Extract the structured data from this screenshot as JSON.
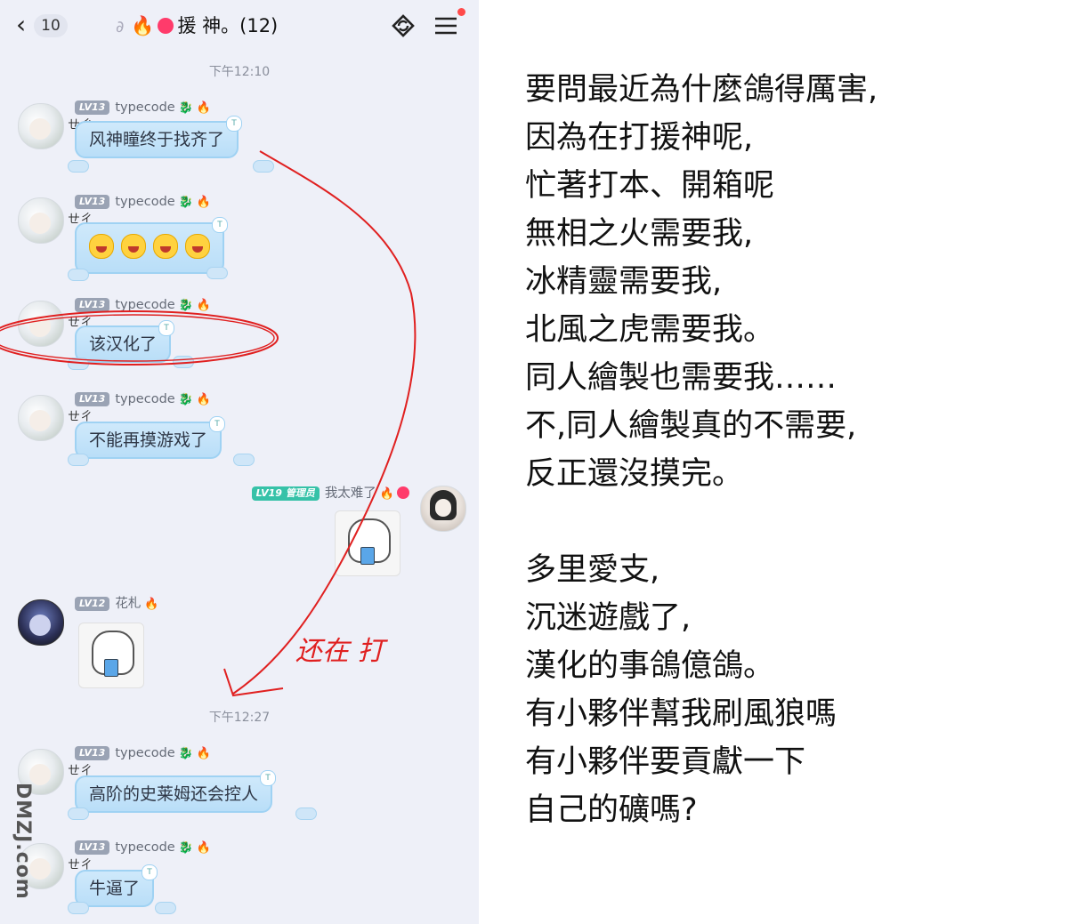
{
  "header": {
    "unread_count": "10",
    "group_title": "援 神。(12)"
  },
  "timestamps": [
    "下午12:10",
    "下午12:27"
  ],
  "messages": [
    {
      "level": "LV13",
      "user": "typecode",
      "text": "风神瞳终于找齐了"
    },
    {
      "level": "LV13",
      "user": "typecode",
      "text": ""
    },
    {
      "level": "LV13",
      "user": "typecode",
      "text": "该汉化了"
    },
    {
      "level": "LV13",
      "user": "typecode",
      "text": "不能再摸游戏了"
    },
    {
      "level": "LV19",
      "role": "管理员",
      "user": "我太难了"
    },
    {
      "level": "LV12",
      "user": "花札"
    },
    {
      "level": "LV13",
      "user": "typecode",
      "text": "高阶的史莱姆还会控人"
    },
    {
      "level": "LV13",
      "user": "typecode",
      "text": "牛逼了"
    }
  ],
  "handwritten_note": "还在 打",
  "watermark": "DMZJ.com",
  "poem": [
    "要問最近為什麼鴿得厲害,",
    "因為在打援神呢,",
    "忙著打本、開箱呢",
    "無相之火需要我,",
    "冰精靈需要我,",
    "北風之虎需要我。",
    "同人繪製也需要我……",
    "不,同人繪製真的不需要,",
    "反正還沒摸完。",
    "",
    "多里愛支,",
    "沉迷遊戲了,",
    "漢化的事鴿億鴿。",
    "有小夥伴幫我刷風狼嗎",
    "有小夥伴要貢獻一下",
    "自己的礦嗎?"
  ],
  "colors": {
    "chat_bg": "#eef0f8",
    "bubble": "#c6e4fa",
    "annotation_red": "#e02020",
    "admin_badge": "#36c2a8"
  }
}
